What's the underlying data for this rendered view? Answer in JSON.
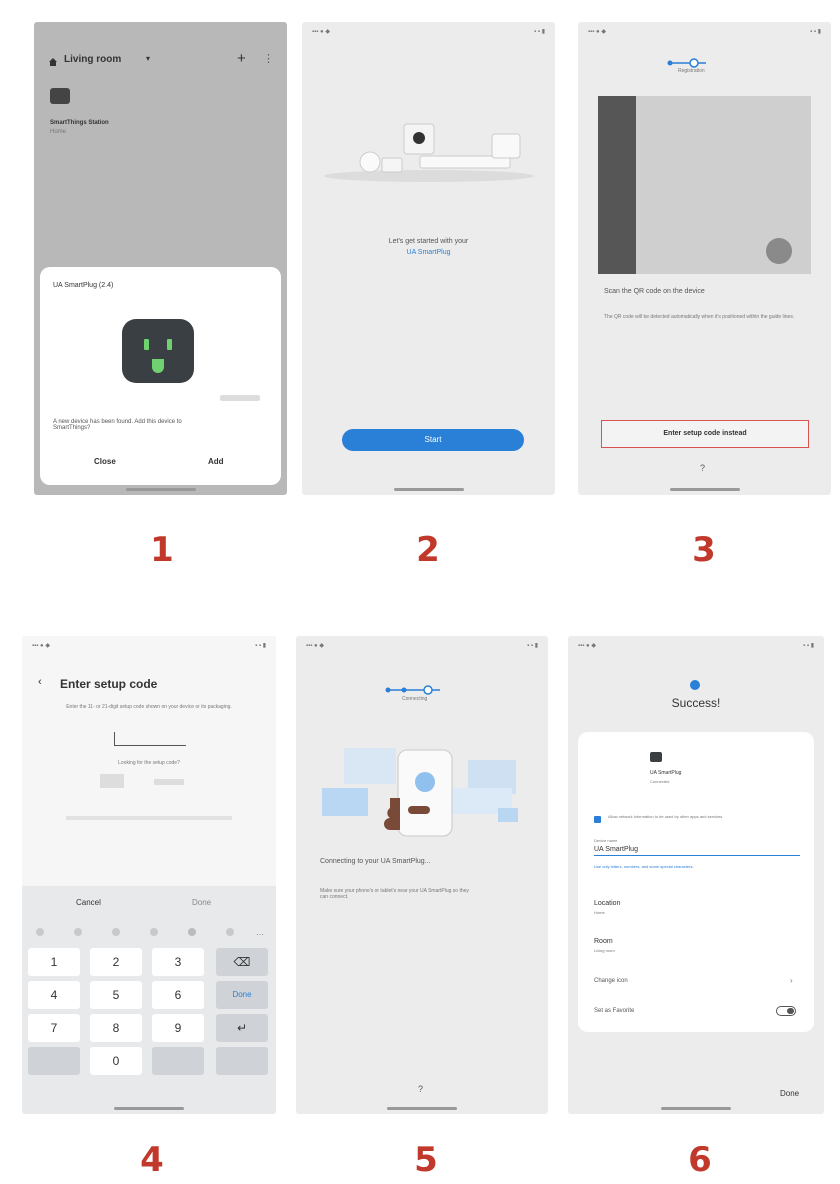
{
  "steps": [
    "1",
    "2",
    "3",
    "4",
    "5",
    "6"
  ],
  "s1": {
    "title": "Living room",
    "device_name": "SmartThings Station",
    "device_room": "Home",
    "sheet_title": "UA SmartPlug (2.4)",
    "question": "A new device has been found. Add this device to SmartThings?",
    "close": "Close",
    "add": "Add"
  },
  "s2": {
    "intro": "Let's get started with your",
    "device": "UA SmartPlug",
    "start": "Start"
  },
  "s3": {
    "progress": "Registration",
    "scan_title": "Scan the QR code on the device",
    "scan_help": "The QR code will be detected automatically when it's positioned within the guide lines.",
    "enter_code": "Enter setup code instead",
    "help": "?"
  },
  "s4": {
    "title": "Enter setup code",
    "instructions": "Enter the 11- or 21-digit setup code shown on your device or its packaging.",
    "hint": "Looking for the setup code?",
    "cancel": "Cancel",
    "done": "Done",
    "keys": [
      "1",
      "2",
      "3",
      "4",
      "5",
      "6",
      "7",
      "8",
      "9",
      "0"
    ],
    "done_key": "Done"
  },
  "s5": {
    "progress": "Connecting",
    "connecting": "Connecting to your UA SmartPlug...",
    "note": "Make sure your phone's or tablet's near your UA SmartPlug so they can connect.",
    "help": "?"
  },
  "s6": {
    "title": "Success!",
    "device": "UA SmartPlug",
    "device_sub": "Connected",
    "checkbox_text": "Allow network information to be used by other apps and services.",
    "name_label": "Device name",
    "name_value": "UA SmartPlug",
    "name_note": "Use only letters, numbers, and some special characters.",
    "location_label": "Location",
    "location_value": "Home",
    "room_label": "Room",
    "room_value": "Living room",
    "change_icon": "Change icon",
    "favorite": "Set as Favorite",
    "done": "Done"
  }
}
